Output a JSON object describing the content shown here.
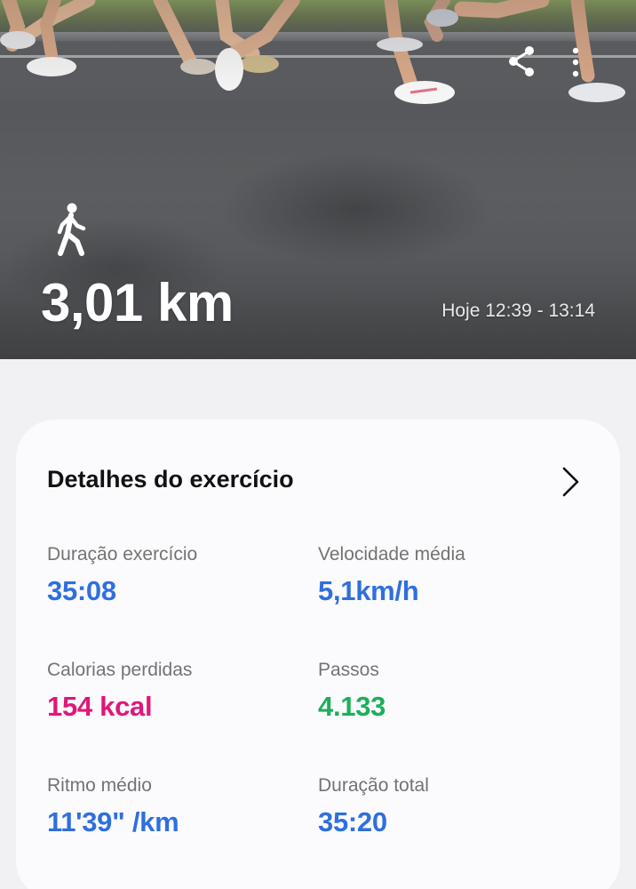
{
  "hero": {
    "activity_icon": "walking-person-icon",
    "share_icon": "share-icon",
    "more_icon": "more-vertical-icon",
    "distance": "3,01 km",
    "time_range": "Hoje 12:39 - 13:14"
  },
  "details": {
    "title": "Detalhes do exercício",
    "chevron_icon": "chevron-right-icon",
    "stats": [
      {
        "label": "Duração exercício",
        "value": "35:08",
        "color": "#2f6fde"
      },
      {
        "label": "Velocidade média",
        "value": "5,1km/h",
        "color": "#2f6fde"
      },
      {
        "label": "Calorias perdidas",
        "value": "154 kcal",
        "color": "#e0177a"
      },
      {
        "label": "Passos",
        "value": "4.133",
        "color": "#1fae5b"
      },
      {
        "label": "Ritmo médio",
        "value": "11'39\" /km",
        "color": "#2f6fde"
      },
      {
        "label": "Duração total",
        "value": "35:20",
        "color": "#2f6fde"
      }
    ]
  }
}
